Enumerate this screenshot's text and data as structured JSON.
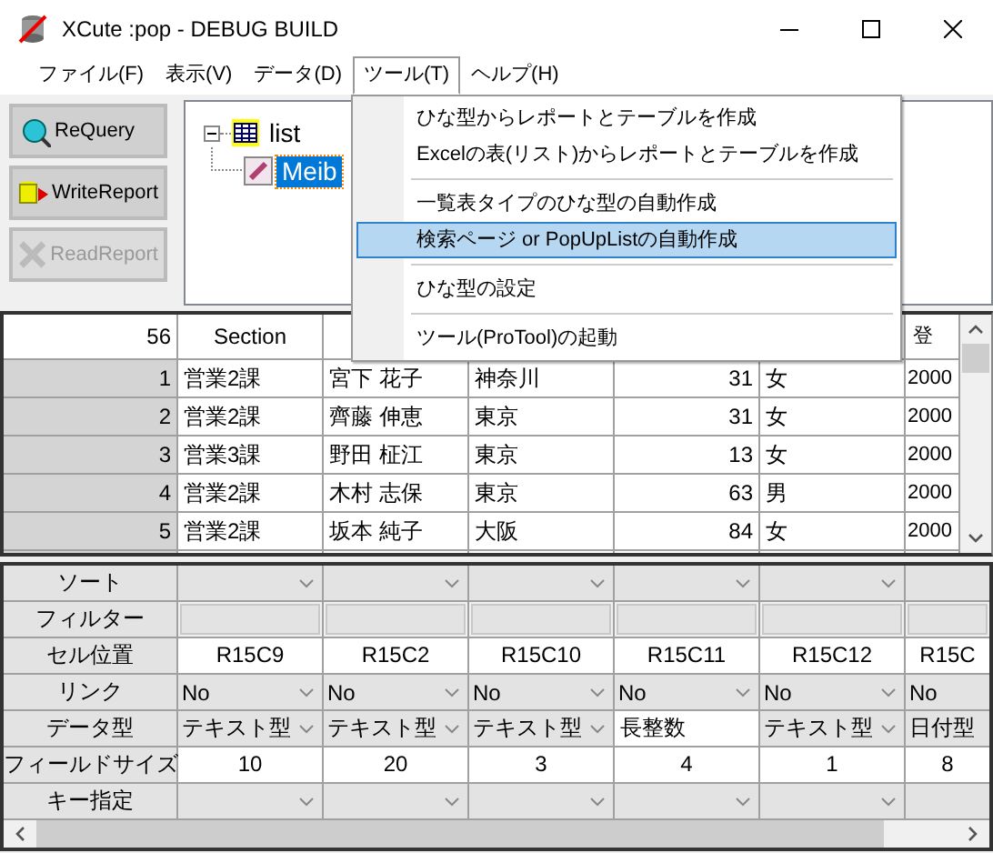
{
  "window": {
    "title": "XCute :pop - DEBUG BUILD"
  },
  "menu_bar": [
    {
      "label": "ファイル(F)",
      "selected": false
    },
    {
      "label": "表示(V)",
      "selected": false
    },
    {
      "label": "データ(D)",
      "selected": false
    },
    {
      "label": "ツール(T)",
      "selected": true
    },
    {
      "label": "ヘルプ(H)",
      "selected": false
    }
  ],
  "open_menu": {
    "items": [
      {
        "kind": "item",
        "label": "ひな型からレポートとテーブルを作成",
        "selected": false
      },
      {
        "kind": "item",
        "label": "Excelの表(リスト)からレポートとテーブルを作成",
        "selected": false
      },
      {
        "kind": "separator"
      },
      {
        "kind": "item",
        "label": "一覧表タイプのひな型の自動作成",
        "selected": false
      },
      {
        "kind": "item",
        "label": "検索ページ or PopUpListの自動作成",
        "selected": true
      },
      {
        "kind": "separator"
      },
      {
        "kind": "item",
        "label": "ひな型の設定",
        "selected": false
      },
      {
        "kind": "separator"
      },
      {
        "kind": "item",
        "label": "ツール(ProTool)の起動",
        "selected": false
      }
    ]
  },
  "tool_buttons": [
    {
      "label": "ReQuery",
      "disabled": false
    },
    {
      "label": "WriteReport",
      "disabled": false
    },
    {
      "label": "ReadReport",
      "disabled": true
    }
  ],
  "tree": {
    "label": "list",
    "expanded": true,
    "children": [
      {
        "label": "Meib",
        "selected": true
      }
    ]
  },
  "grid": {
    "header": {
      "column_1": "56",
      "column_2": "Section",
      "column_7": "登"
    },
    "rows": [
      [
        "1",
        "営業2課",
        "宮下 花子",
        "神奈川",
        "31",
        "女",
        "2000"
      ],
      [
        "2",
        "営業2課",
        "齊藤 伸恵",
        "東京",
        "31",
        "女",
        "2000"
      ],
      [
        "3",
        "営業3課",
        "野田 柾江",
        "東京",
        "13",
        "女",
        "2000"
      ],
      [
        "4",
        "営業2課",
        "木村 志保",
        "東京",
        "63",
        "男",
        "2000"
      ],
      [
        "5",
        "営業2課",
        "坂本 純子",
        "大阪",
        "84",
        "女",
        "2000"
      ]
    ]
  },
  "properties": {
    "rows": [
      {
        "label": "ソート",
        "cells": [
          {
            "kind": "combo"
          },
          {
            "kind": "combo"
          },
          {
            "kind": "combo"
          },
          {
            "kind": "combo"
          },
          {
            "kind": "combo"
          },
          {
            "kind": "combo"
          }
        ]
      },
      {
        "label": "フィルター",
        "cells": [
          {
            "kind": "field"
          },
          {
            "kind": "field"
          },
          {
            "kind": "field"
          },
          {
            "kind": "field"
          },
          {
            "kind": "field"
          },
          {
            "kind": "field"
          }
        ]
      },
      {
        "label": "セル位置",
        "cells": [
          {
            "kind": "text",
            "value": "R15C9"
          },
          {
            "kind": "text",
            "value": "R15C2"
          },
          {
            "kind": "text",
            "value": "R15C10"
          },
          {
            "kind": "text",
            "value": "R15C11"
          },
          {
            "kind": "text",
            "value": "R15C12"
          },
          {
            "kind": "text",
            "value": "R15C"
          }
        ]
      },
      {
        "label": "リンク",
        "cells": [
          {
            "kind": "combo",
            "value": "No"
          },
          {
            "kind": "combo",
            "value": "No"
          },
          {
            "kind": "combo",
            "value": "No"
          },
          {
            "kind": "combo",
            "value": "No"
          },
          {
            "kind": "combo",
            "value": "No"
          },
          {
            "kind": "combo",
            "value": "No"
          }
        ]
      },
      {
        "label": "データ型",
        "cells": [
          {
            "kind": "combo",
            "value": "テキスト型"
          },
          {
            "kind": "combo",
            "value": "テキスト型"
          },
          {
            "kind": "combo",
            "value": "テキスト型"
          },
          {
            "kind": "input",
            "value": "長整数"
          },
          {
            "kind": "combo",
            "value": "テキスト型"
          },
          {
            "kind": "combo",
            "value": "日付型"
          }
        ]
      },
      {
        "label": "フィールドサイズ",
        "cells": [
          {
            "kind": "text",
            "value": "10"
          },
          {
            "kind": "text",
            "value": "20"
          },
          {
            "kind": "text",
            "value": "3"
          },
          {
            "kind": "text",
            "value": "4"
          },
          {
            "kind": "text",
            "value": "1"
          },
          {
            "kind": "text",
            "value": "8"
          }
        ]
      },
      {
        "label": "キー指定",
        "cells": [
          {
            "kind": "combo"
          },
          {
            "kind": "combo"
          },
          {
            "kind": "combo"
          },
          {
            "kind": "combo"
          },
          {
            "kind": "combo"
          },
          {
            "kind": "combo"
          }
        ]
      }
    ]
  }
}
